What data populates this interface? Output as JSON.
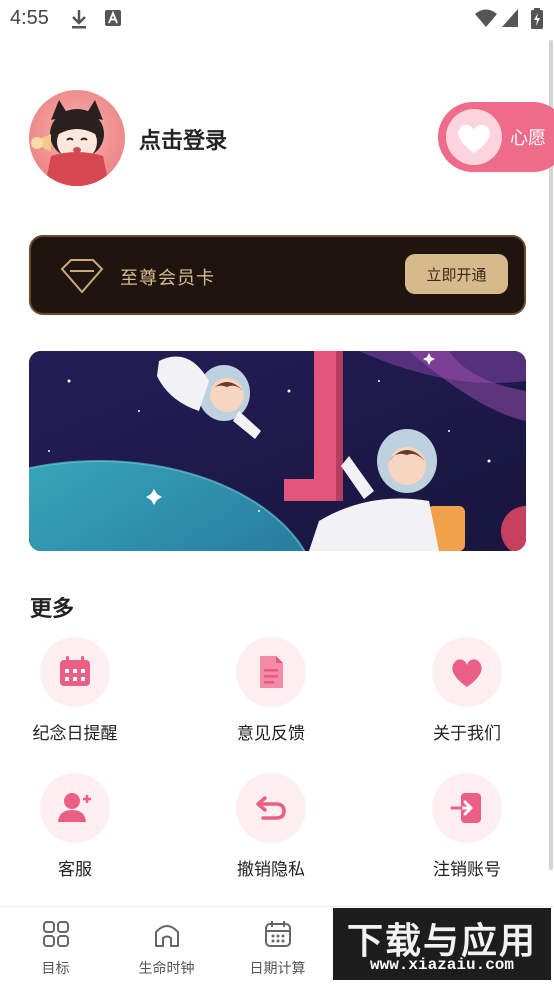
{
  "status_bar": {
    "time": "4:55",
    "icons": [
      "download-icon",
      "text-a-icon",
      "wifi-icon",
      "signal-icon",
      "battery-charging-icon"
    ]
  },
  "profile": {
    "login_text": "点击登录",
    "wish_label": "心愿"
  },
  "vip": {
    "title": "至尊会员卡",
    "button": "立即开通"
  },
  "more": {
    "title": "更多",
    "items": [
      {
        "label": "纪念日提醒",
        "icon": "calendar-icon"
      },
      {
        "label": "意见反馈",
        "icon": "document-icon"
      },
      {
        "label": "关于我们",
        "icon": "heart-icon"
      },
      {
        "label": "客服",
        "icon": "user-add-icon"
      },
      {
        "label": "撤销隐私",
        "icon": "undo-icon"
      },
      {
        "label": "注销账号",
        "icon": "logout-icon"
      }
    ]
  },
  "tabs": [
    {
      "label": "目标",
      "icon": "grid-icon"
    },
    {
      "label": "生命时钟",
      "icon": "home-icon"
    },
    {
      "label": "日期计算",
      "icon": "calendar-icon"
    }
  ],
  "watermark": {
    "title": "下载与应用",
    "url": "www.xiazaiu.com"
  },
  "colors": {
    "accent_pink": "#ee6b89",
    "vip_gold": "#d6ba8c",
    "vip_bg": "#1f140e",
    "icon_bg": "#fdeef1"
  }
}
